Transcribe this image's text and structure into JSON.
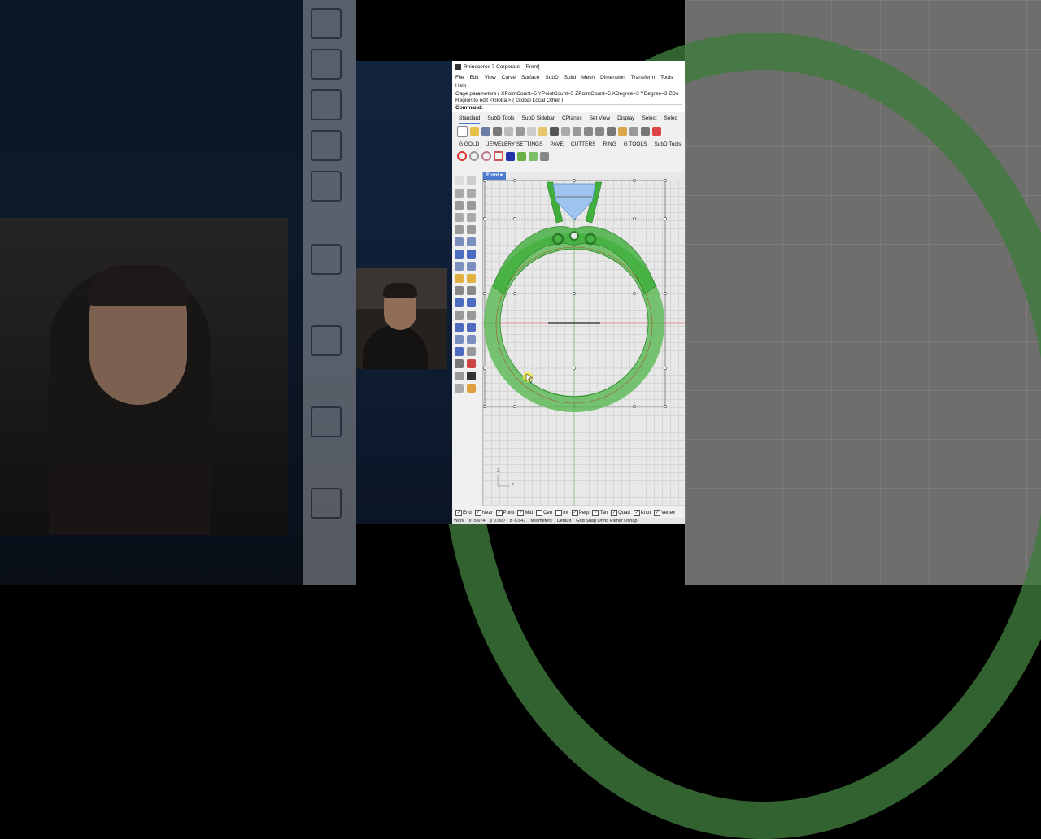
{
  "window": {
    "title": "Rhinoceros 7 Corporate - [Front]"
  },
  "menu": [
    "File",
    "Edit",
    "View",
    "Curve",
    "Surface",
    "SubD",
    "Solid",
    "Mesh",
    "Dimension",
    "Transform",
    "Tools",
    "Help"
  ],
  "command": {
    "history_1": "Cage parameters ( XPointCount=5  YPointCount=5  ZPointCount=5  XDegree=3  YDegree=3  ZDe",
    "history_2": "Region to edit <Global> ( Global  Local  Other )",
    "prompt_label": "Command:",
    "input_value": ""
  },
  "tabs_row1": [
    "Standard",
    "SubD Tools",
    "SubD Sidebar",
    "CPlanes",
    "Set View",
    "Display",
    "Select",
    "Selec"
  ],
  "tabs_row2": [
    "G GOLD",
    "JEWELERY SETTINGS",
    "PAVE",
    "CUTTERS",
    "RING",
    "G TOOLS",
    "SubD Tools"
  ],
  "viewport": {
    "label": "Front",
    "axis_z": "z",
    "axis_x": "x"
  },
  "osnaps": [
    {
      "label": "End",
      "checked": true
    },
    {
      "label": "Near",
      "checked": true
    },
    {
      "label": "Point",
      "checked": true
    },
    {
      "label": "Mid",
      "checked": true
    },
    {
      "label": "Cen",
      "checked": false
    },
    {
      "label": "Int",
      "checked": false
    },
    {
      "label": "Perp",
      "checked": true
    },
    {
      "label": "Tan",
      "checked": true
    },
    {
      "label": "Quad",
      "checked": true
    },
    {
      "label": "Knot",
      "checked": true
    },
    {
      "label": "Vertex",
      "checked": true
    }
  ],
  "status": {
    "cplane": "Work",
    "x": "x -5.674",
    "y": "y 0.000",
    "z": "z -5.647",
    "units": "Millimeters",
    "layer": "Default",
    "modes": "Grid Snap  Ortho  Planar  Osnap"
  },
  "colors": {
    "ring_green": "#4fb54a",
    "gem_blue": "#9ec3ee",
    "viewport_label": "#4a7bd0"
  }
}
